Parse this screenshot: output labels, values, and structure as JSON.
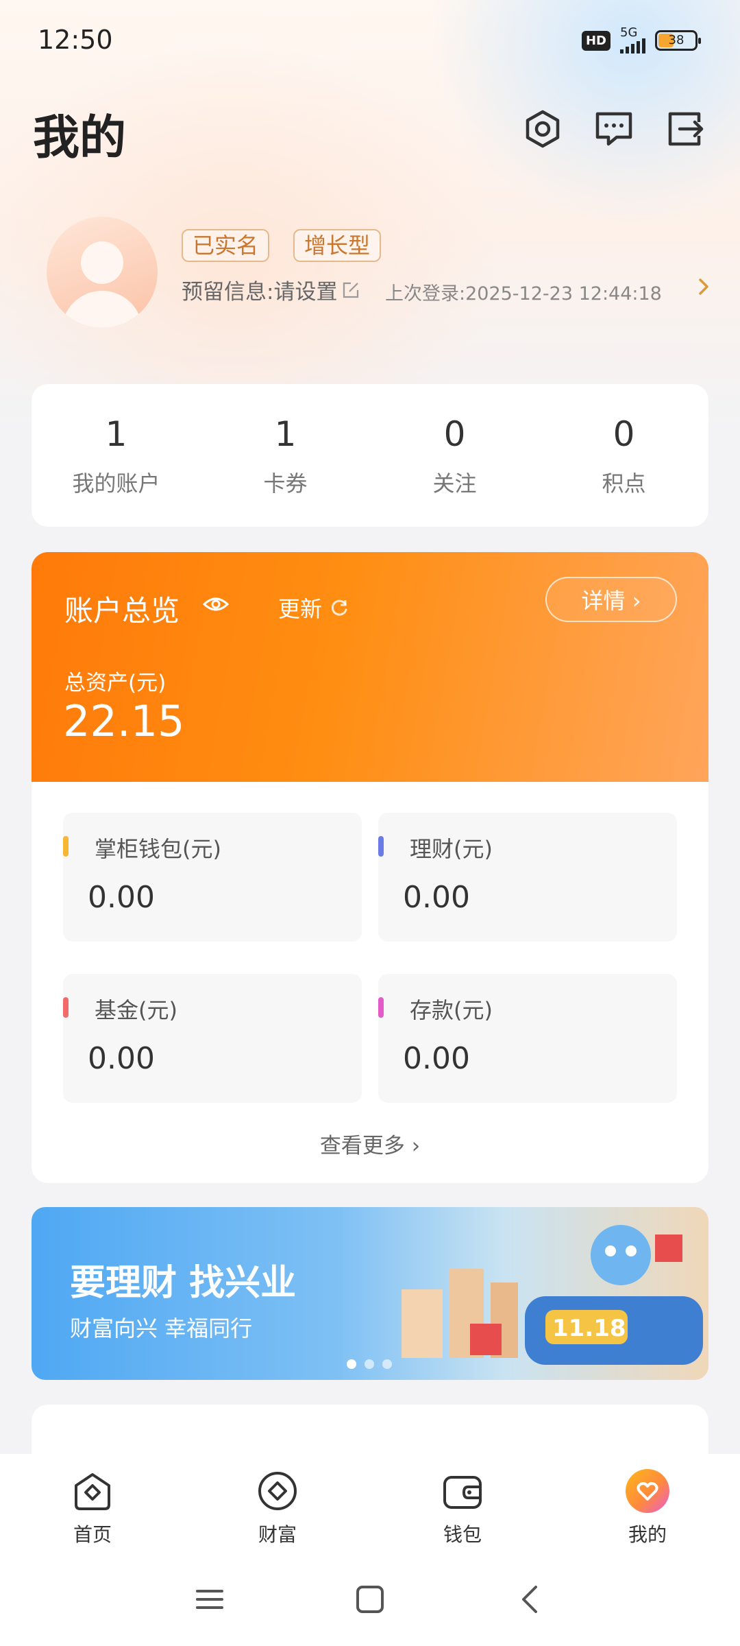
{
  "status_bar": {
    "time": "12:50",
    "hd": "HD",
    "network": "5G",
    "battery": "38"
  },
  "header": {
    "title": "我的",
    "icons": [
      "settings-icon",
      "message-icon",
      "logout-icon"
    ]
  },
  "profile": {
    "tags": [
      "已实名",
      "增长型"
    ],
    "reserve_info": "预留信息:请设置",
    "last_login": "上次登录:2025-12-23 12:44:18"
  },
  "stats": [
    {
      "value": "1",
      "label": "我的账户"
    },
    {
      "value": "1",
      "label": "卡券"
    },
    {
      "value": "0",
      "label": "关注"
    },
    {
      "value": "0",
      "label": "积点"
    }
  ],
  "overview": {
    "title": "账户总览",
    "refresh": "更新",
    "detail": "详情",
    "total_label": "总资产(元)",
    "total_value": "22.15",
    "items": [
      {
        "label": "掌柜钱包(元)",
        "value": "0.00",
        "color": "#f7b733"
      },
      {
        "label": "理财(元)",
        "value": "0.00",
        "color": "#6b7be6"
      },
      {
        "label": "基金(元)",
        "value": "0.00",
        "color": "#f26b6b"
      },
      {
        "label": "存款(元)",
        "value": "0.00",
        "color": "#e25bc9"
      }
    ],
    "more": "查看更多 ›"
  },
  "banner": {
    "title": "要理财 找兴业",
    "subtitle": "财富向兴 幸福同行",
    "badge": "11.18"
  },
  "tabs": [
    {
      "label": "首页",
      "icon": "home-icon"
    },
    {
      "label": "财富",
      "icon": "wealth-icon"
    },
    {
      "label": "钱包",
      "icon": "wallet-icon"
    },
    {
      "label": "我的",
      "icon": "me-icon",
      "active": true
    }
  ],
  "colors": {
    "accent": "#ff8a1a",
    "tag_border": "#e6b98a",
    "tag_text": "#c9772e"
  }
}
